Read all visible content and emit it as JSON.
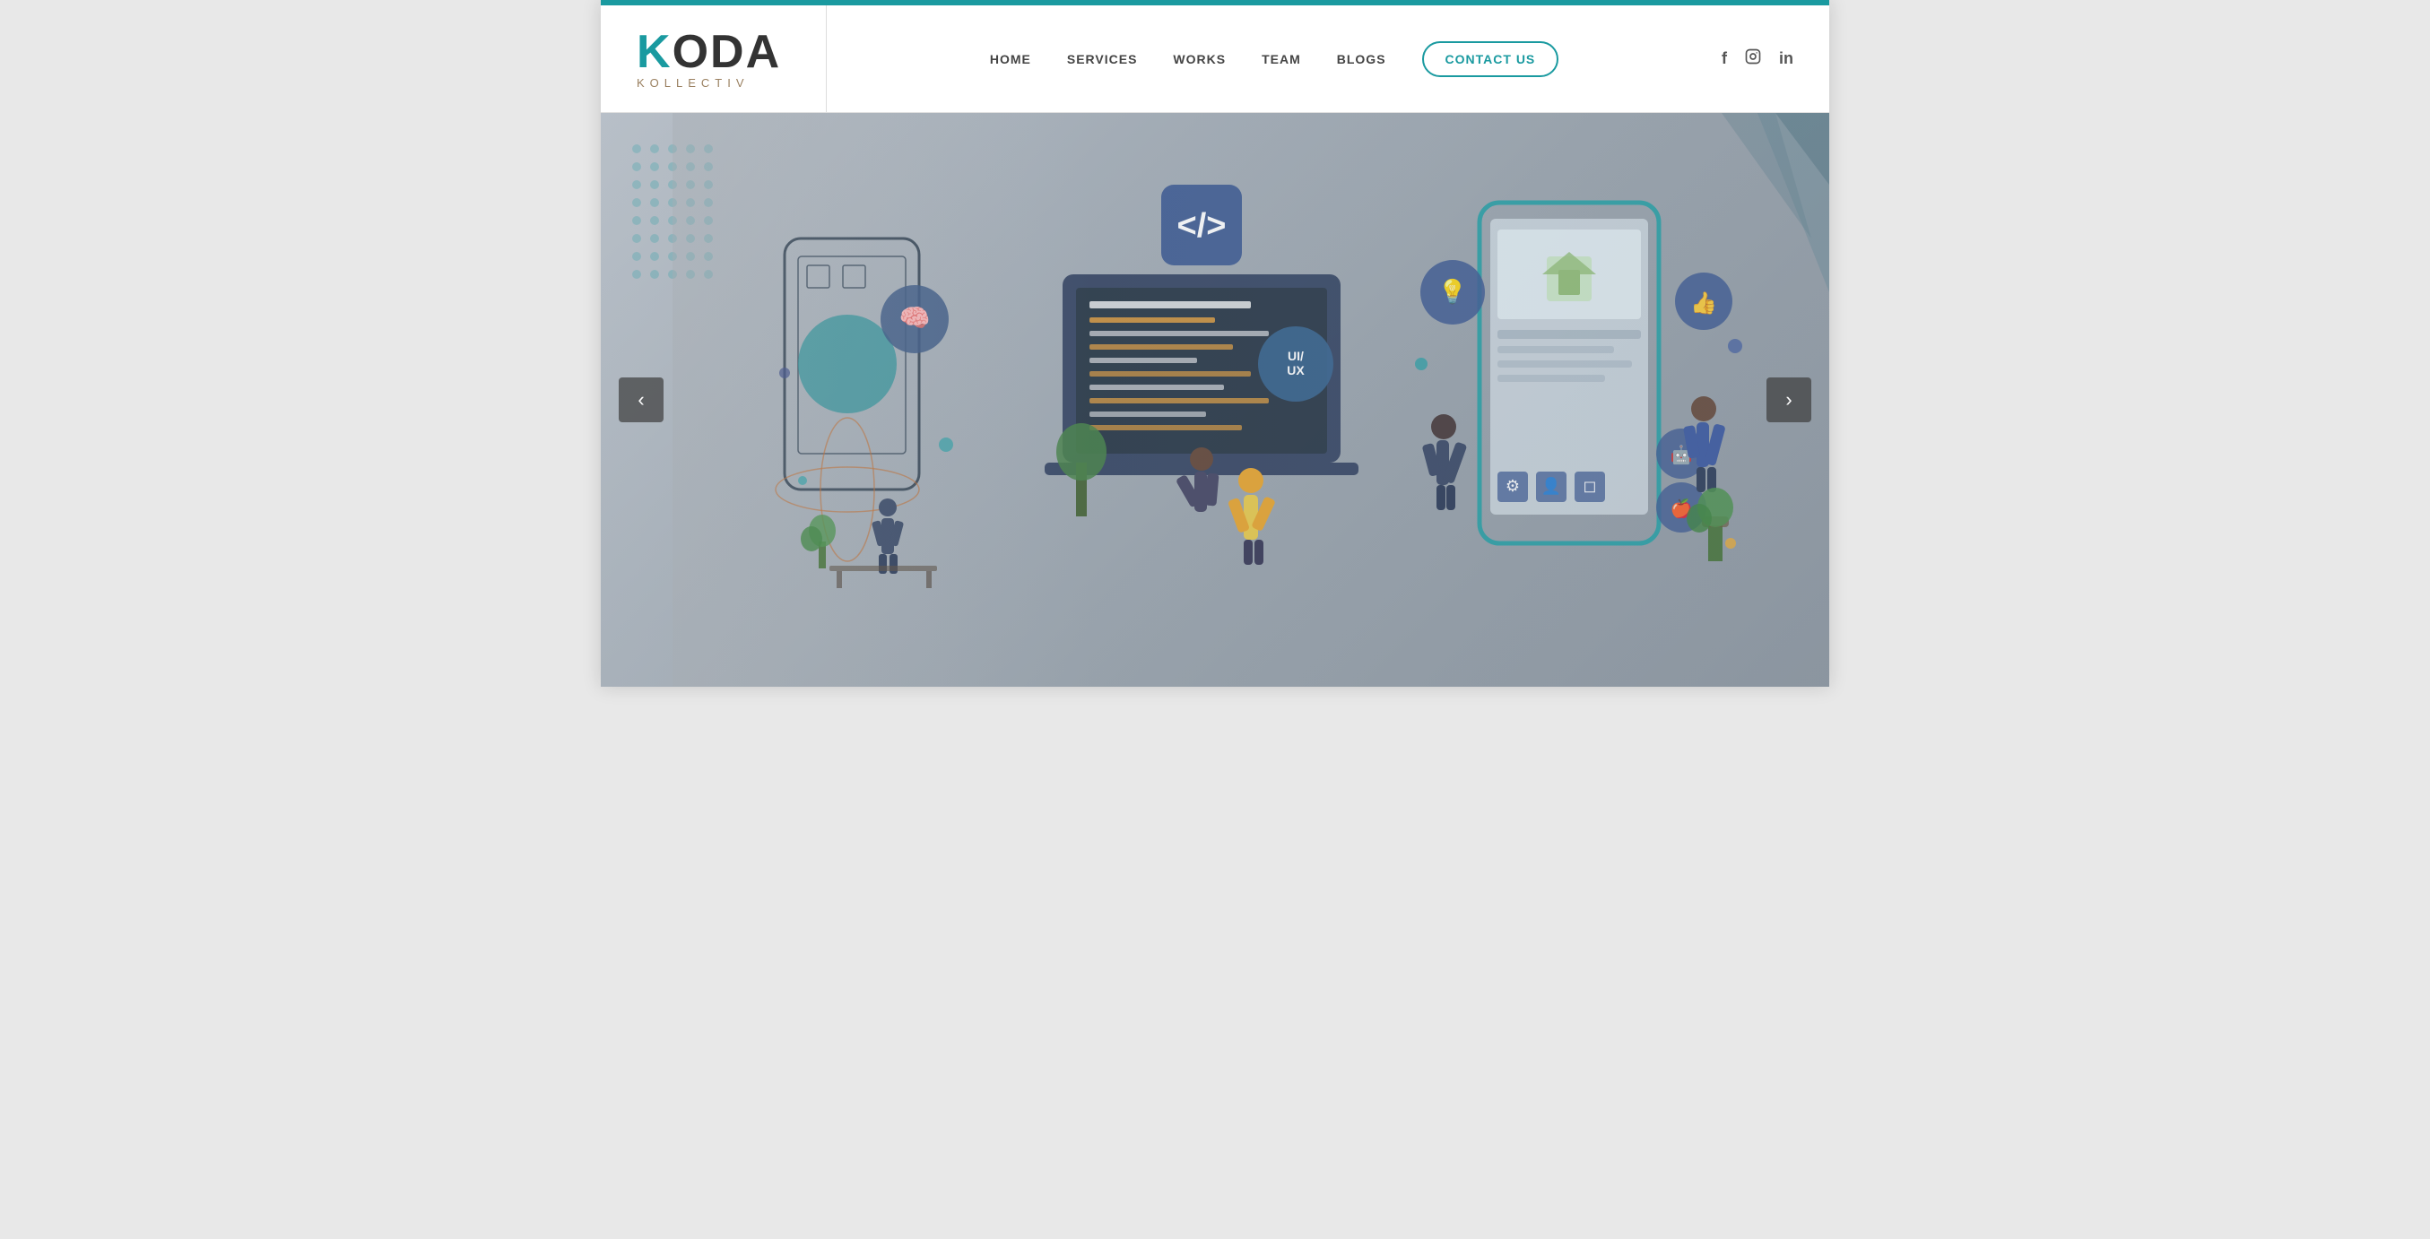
{
  "brand": {
    "logo_main": "KODA",
    "logo_k": "K",
    "logo_oda": "ODA",
    "logo_sub": "KOLLECTIV"
  },
  "nav": {
    "links": [
      {
        "label": "HOME",
        "id": "home"
      },
      {
        "label": "SERVICES",
        "id": "services"
      },
      {
        "label": "WORKS",
        "id": "works"
      },
      {
        "label": "TEAM",
        "id": "team"
      },
      {
        "label": "BLOGS",
        "id": "blogs"
      }
    ],
    "contact_label": "CONTACT US"
  },
  "social": [
    {
      "label": "f",
      "name": "facebook",
      "symbol": "f"
    },
    {
      "label": "ig",
      "name": "instagram",
      "symbol": "◻"
    },
    {
      "label": "in",
      "name": "linkedin",
      "symbol": "in"
    }
  ],
  "hero": {
    "prev_label": "‹",
    "next_label": "›",
    "bg_color": "#b8c0c8"
  },
  "colors": {
    "accent": "#1a9aa0",
    "nav_text": "#444444",
    "logo_koda": "#333333",
    "logo_sub": "#9a8060",
    "top_bar": "#1a9aa0"
  }
}
